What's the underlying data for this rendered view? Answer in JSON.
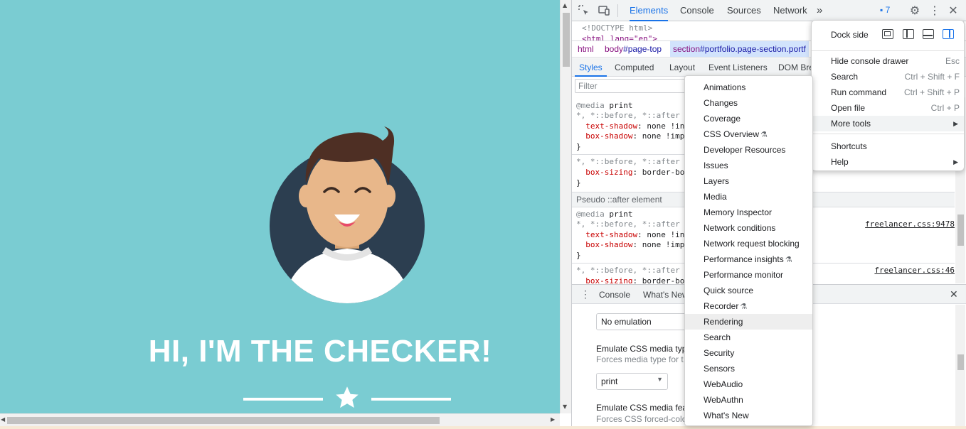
{
  "page": {
    "hero_title": "HI, I'M THE CHECKER!"
  },
  "devtools": {
    "tabs": [
      "Elements",
      "Console",
      "Sources",
      "Network"
    ],
    "more_tabs": "»",
    "issues_count": "7",
    "dom_lines": [
      "<!DOCTYPE html>",
      "<html lang=\"en\">"
    ],
    "breadcrumb": [
      {
        "tag": "html",
        "rest": ""
      },
      {
        "tag": "body",
        "rest": "#page-top"
      },
      {
        "tag": "section",
        "rest": "#portfolio.page-section.portf"
      }
    ],
    "subtabs": [
      "Styles",
      "Computed",
      "Layout",
      "Event Listeners",
      "DOM Bre"
    ],
    "filter_placeholder": "Filter",
    "styles": {
      "media1": "@media",
      "media1_value": "print",
      "selector1": "*, *::before, *::after",
      "prop_text_shadow": "text-shadow",
      "val_text_shadow": ": none !in",
      "prop_box_shadow": "box-shadow",
      "val_box_shadow": ": none !imp",
      "close_brace": "}",
      "selector2": "*, *::before, *::after",
      "prop_box_sizing": "box-sizing",
      "val_box_sizing": ": border-bo",
      "pseudo_header": "Pseudo ::after element",
      "media2": "@media",
      "media2_value": "print",
      "selector3": "*, *::before, *::after",
      "val_text_shadow2": ": none !in",
      "val_box_shadow2": ": none !imp",
      "source1": "freelancer.css:9478",
      "selector4": "*, *::before, *::after",
      "source2": "freelancer.css:46",
      "val_box_sizing2": ": border-bo"
    },
    "drawer_tabs": [
      "Console",
      "What's New"
    ],
    "rendering": {
      "emulation_value": "No emulation",
      "media_type_label": "Emulate CSS media typ",
      "media_type_desc": "Forces media type for t",
      "media_type_value": "print",
      "media_feature_label": "Emulate CSS media feat",
      "media_feature_desc": "Forces CSS forced-colo"
    }
  },
  "main_menu": {
    "dock_side_label": "Dock side",
    "items": [
      {
        "label": "Hide console drawer",
        "shortcut": "Esc"
      },
      {
        "label": "Search",
        "shortcut": "Ctrl + Shift + F"
      },
      {
        "label": "Run command",
        "shortcut": "Ctrl + Shift + P"
      },
      {
        "label": "Open file",
        "shortcut": "Ctrl + P"
      },
      {
        "label": "More tools",
        "shortcut": ""
      },
      {
        "label": "Shortcuts",
        "shortcut": ""
      },
      {
        "label": "Help",
        "shortcut": ""
      }
    ]
  },
  "more_tools_menu": {
    "items": [
      "Animations",
      "Changes",
      "Coverage",
      "CSS Overview",
      "Developer Resources",
      "Issues",
      "Layers",
      "Media",
      "Memory Inspector",
      "Network conditions",
      "Network request blocking",
      "Performance insights",
      "Performance monitor",
      "Quick source",
      "Recorder",
      "Rendering",
      "Search",
      "Security",
      "Sensors",
      "WebAudio",
      "WebAuthn",
      "What's New"
    ],
    "highlighted": "Rendering"
  },
  "colors": {
    "page_bg": "#7accd2",
    "accent": "#1a73e8",
    "avatar_bg": "#2c3e50"
  }
}
